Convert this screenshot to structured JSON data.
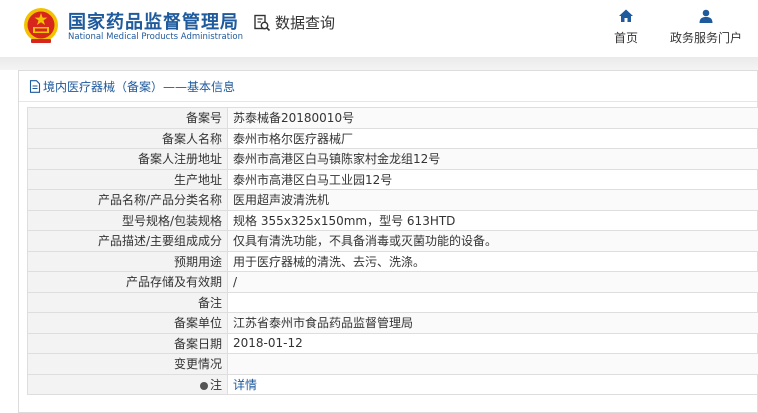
{
  "header": {
    "brand_cn": "国家药品监督管理局",
    "brand_en": "National Medical Products Administration",
    "query_label": "数据查询",
    "nav": [
      {
        "label": "首页",
        "icon": "home-icon"
      },
      {
        "label": "政务服务门户",
        "icon": "user-icon"
      }
    ]
  },
  "breadcrumb": "境内医疗器械（备案）——基本信息",
  "rows": [
    {
      "label": "备案号",
      "value": "苏泰械备20180010号"
    },
    {
      "label": "备案人名称",
      "value": "泰州市格尔医疗器械厂"
    },
    {
      "label": "备案人注册地址",
      "value": "泰州市高港区白马镇陈家村金龙组12号"
    },
    {
      "label": "生产地址",
      "value": "泰州市高港区白马工业园12号"
    },
    {
      "label": "产品名称/产品分类名称",
      "value": "医用超声波清洗机"
    },
    {
      "label": "型号规格/包装规格",
      "value": "规格 355x325x150mm，型号 613HTD"
    },
    {
      "label": "产品描述/主要组成成分",
      "value": "仅具有清洗功能，不具备消毒或灭菌功能的设备。"
    },
    {
      "label": "预期用途",
      "value": "用于医疗器械的清洗、去污、洗涤。"
    },
    {
      "label": "产品存储及有效期",
      "value": "/"
    },
    {
      "label": "备注",
      "value": ""
    },
    {
      "label": "备案单位",
      "value": "江苏省泰州市食品药品监督管理局"
    },
    {
      "label": "备案日期",
      "value": "2018-01-12"
    },
    {
      "label": "变更情况",
      "value": ""
    },
    {
      "label": "注",
      "value": "详情"
    }
  ],
  "colors": {
    "brand_blue": "#1f5a9c",
    "emblem_red": "#d7261c",
    "emblem_gold": "#f2c200"
  }
}
